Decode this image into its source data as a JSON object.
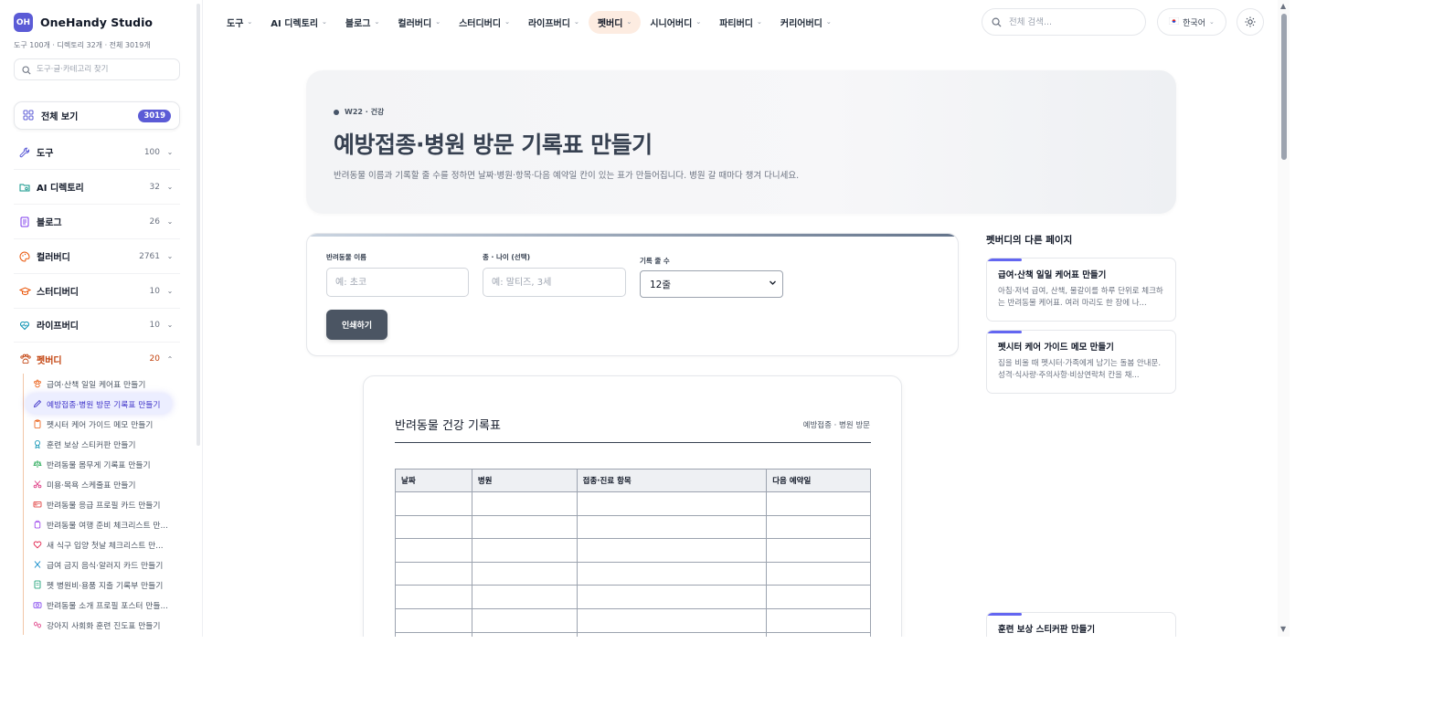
{
  "sidebar": {
    "brand_logo": "OH",
    "brand_name": "OneHandy Studio",
    "meta": "도구 100개 · 디렉토리 32개 · 전체 3019개",
    "search_placeholder": "도구·글·카테고리 찾기",
    "all_view": {
      "label": "전체 보기",
      "count": "3019"
    },
    "categories": [
      {
        "name": "도구",
        "count": "100",
        "icon": "wrench-icon"
      },
      {
        "name": "AI 디렉토리",
        "count": "32",
        "icon": "folder-ai-icon"
      },
      {
        "name": "블로그",
        "count": "26",
        "icon": "document-icon"
      },
      {
        "name": "컬러버디",
        "count": "2761",
        "icon": "palette-icon"
      },
      {
        "name": "스터디버디",
        "count": "10",
        "icon": "graduation-cap-icon"
      },
      {
        "name": "라이프버디",
        "count": "10",
        "icon": "heart-pulse-icon"
      },
      {
        "name": "펫버디",
        "count": "20",
        "icon": "paw-icon"
      }
    ],
    "pet_items": [
      {
        "label": "급여·산책 일일 케어표 만들기",
        "icon": "paw-icon"
      },
      {
        "label": "예방접종·병원 방문 기록표 만들기",
        "icon": "pencil-icon"
      },
      {
        "label": "펫시터 케어 가이드 메모 만들기",
        "icon": "clipboard-icon"
      },
      {
        "label": "훈련 보상 스티커판 만들기",
        "icon": "award-icon"
      },
      {
        "label": "반려동물 몸무게 기록표 만들기",
        "icon": "scale-icon"
      },
      {
        "label": "미용·목욕 스케줄표 만들기",
        "icon": "scissors-icon"
      },
      {
        "label": "반려동물 응급 프로필 카드 만들기",
        "icon": "id-card-icon"
      },
      {
        "label": "반려동물 여행 준비 체크리스트 만...",
        "icon": "luggage-icon"
      },
      {
        "label": "새 식구 입양 첫날 체크리스트 만...",
        "icon": "heart-icon"
      },
      {
        "label": "급여 금지 음식·알러지 카드 만들기",
        "icon": "utensils-icon"
      },
      {
        "label": "펫 병원비·용품 지출 기록부 만들기",
        "icon": "receipt-icon"
      },
      {
        "label": "반려동물 소개 프로필 포스터 만들...",
        "icon": "camera-icon"
      },
      {
        "label": "강아지 사회화 훈련 진도표 만들기",
        "icon": "paw-prints-icon"
      }
    ]
  },
  "topnav": {
    "items": [
      {
        "label": "도구"
      },
      {
        "label": "AI 디렉토리"
      },
      {
        "label": "블로그"
      },
      {
        "label": "컬러버디"
      },
      {
        "label": "스터디버디"
      },
      {
        "label": "라이프버디"
      },
      {
        "label": "펫버디"
      },
      {
        "label": "시니어버디"
      },
      {
        "label": "파티버디"
      },
      {
        "label": "커리어버디"
      }
    ],
    "active_index": 6,
    "search_placeholder": "전체 검색...",
    "language": "한국어"
  },
  "hero": {
    "kicker": "W22 · 건강",
    "title": "예방접종·병원 방문 기록표 만들기",
    "description": "반려동물 이름과 기록할 줄 수를 정하면 날짜·병원·항목·다음 예약일 칸이 있는 표가 만들어집니다. 병원 갈 때마다 챙겨 다니세요."
  },
  "form": {
    "pet_name_label": "반려동물 이름",
    "pet_name_placeholder": "예: 초코",
    "breed_label": "종 · 나이 (선택)",
    "breed_placeholder": "예: 말티즈, 3세",
    "rows_label": "기록 줄 수",
    "rows_value": "12줄",
    "print_label": "인쇄하기"
  },
  "sheet": {
    "title": "반려동물 건강 기록표",
    "subtitle": "예방접종 · 병원 방문",
    "columns": [
      "날짜",
      "병원",
      "접종·진료 항목",
      "다음 예약일"
    ]
  },
  "rail": {
    "title": "펫버디의 다른 페이지",
    "cards": [
      {
        "title": "급여·산책 일일 케어표 만들기",
        "desc": "아침·저녁 급여, 산책, 물갈이를 하루 단위로 체크하는 반려동물 케어표. 여러 마리도 한 장에 나..."
      },
      {
        "title": "펫시터 케어 가이드 메모 만들기",
        "desc": "집을 비울 때 펫시터·가족에게 남기는 돌봄 안내문. 성격·식사량·주의사항·비상연락처 칸을 채..."
      },
      {
        "title": "훈련 보상 스티커판 만들기",
        "desc": ""
      }
    ]
  },
  "colors": {
    "accent": "#5b5bd6",
    "pet_accent": "#c2410c",
    "active_nav_bg": "#fdece1"
  }
}
